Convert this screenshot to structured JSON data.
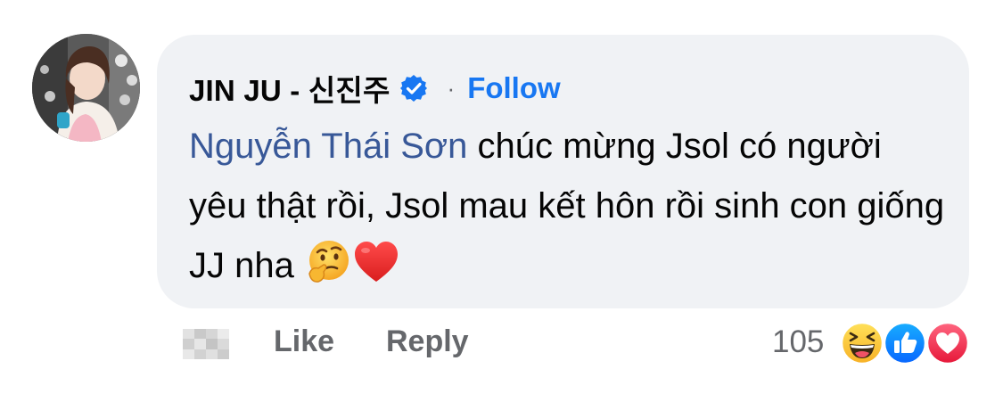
{
  "comment": {
    "author": "JIN JU - 신진주",
    "separator": "·",
    "follow_label": "Follow",
    "mention": "Nguyễn Thái Sơn",
    "text": " chúc mừng Jsol có người yêu thật rồi, Jsol mau kết hôn rồi sinh con giống JJ nha ",
    "emojis": [
      "thinking-face",
      "red-heart"
    ]
  },
  "actions": {
    "like_label": "Like",
    "reply_label": "Reply",
    "reaction_count": "105",
    "reactions": [
      "haha",
      "like",
      "love"
    ]
  },
  "colors": {
    "bubble_bg": "#f0f2f5",
    "link_blue": "#1877f2",
    "mention_blue": "#385898",
    "secondary_text": "#65676b"
  }
}
